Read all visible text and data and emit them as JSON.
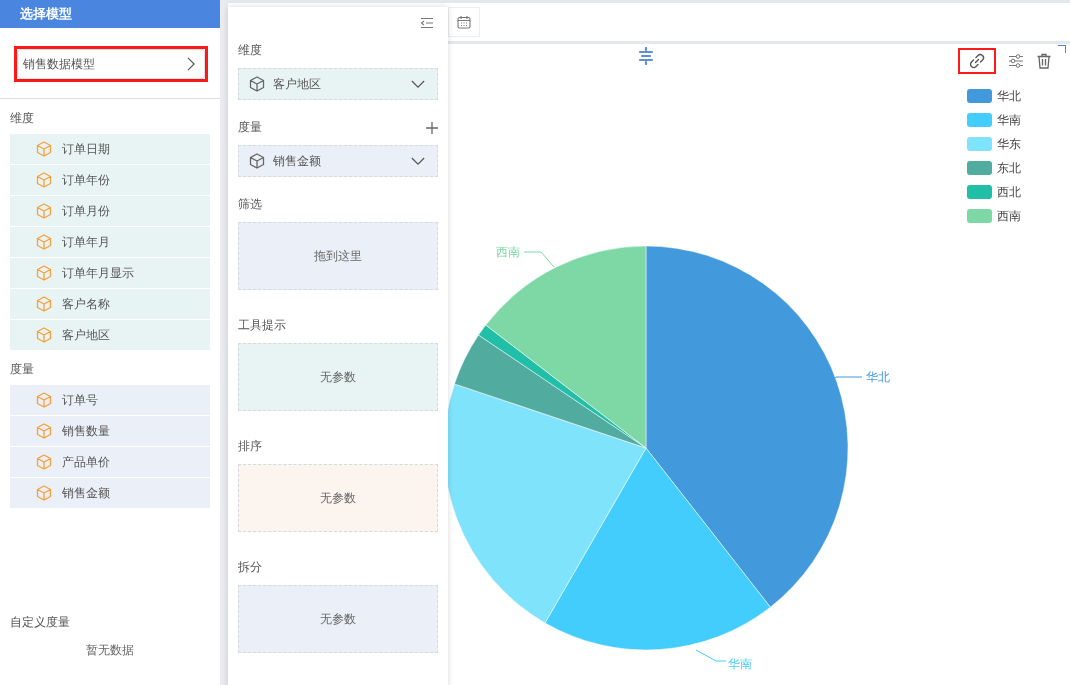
{
  "header": {
    "title": "选择模型"
  },
  "model_button": {
    "label": "销售数据模型",
    "highlighted": true
  },
  "sidebar": {
    "sections": [
      {
        "title": "维度",
        "color": "#e8f4f3",
        "items": [
          "订单日期",
          "订单年份",
          "订单月份",
          "订单年月",
          "订单年月显示",
          "客户名称",
          "客户地区"
        ]
      },
      {
        "title": "度量",
        "color": "#ebeff7",
        "items": [
          "订单号",
          "销售数量",
          "产品单价",
          "销售金额"
        ]
      }
    ],
    "custom": {
      "title": "自定义度量",
      "empty": "暂无数据"
    }
  },
  "panel": {
    "sections": [
      {
        "title": "维度",
        "kind": "select",
        "value": "客户地区",
        "color": "#e8f4f3",
        "addable": false
      },
      {
        "title": "度量",
        "kind": "select",
        "value": "销售金额",
        "color": "#ebeff7",
        "addable": true
      },
      {
        "title": "筛选",
        "kind": "dropzone",
        "text": "拖到这里",
        "color": "#ebeff8",
        "addable": false
      },
      {
        "title": "工具提示",
        "kind": "dropzone",
        "text": "无参数",
        "color": "#e8f4f3",
        "addable": false
      },
      {
        "title": "排序",
        "kind": "dropzone",
        "text": "无参数",
        "color": "#fcf4ee",
        "addable": false
      },
      {
        "title": "拆分",
        "kind": "dropzone",
        "text": "无参数",
        "color": "#ebeff8",
        "addable": false
      }
    ]
  },
  "chart": {
    "link_highlighted": true,
    "legend": [
      {
        "label": "华北",
        "color": "#4299db"
      },
      {
        "label": "华南",
        "color": "#43cdfd"
      },
      {
        "label": "华东",
        "color": "#80e3fc"
      },
      {
        "label": "东北",
        "color": "#52ab9f"
      },
      {
        "label": "西北",
        "color": "#21bfa8"
      },
      {
        "label": "西南",
        "color": "#7dd8a6"
      }
    ],
    "slice_labels": [
      "华北",
      "华南",
      "西南"
    ]
  }
}
